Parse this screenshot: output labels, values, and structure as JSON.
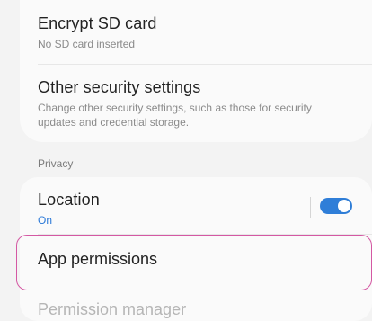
{
  "security": {
    "encrypt_sd": {
      "title": "Encrypt SD card",
      "subtitle": "No SD card inserted"
    },
    "other_security": {
      "title": "Other security settings",
      "subtitle": "Change other security settings, such as those for security updates and credential storage."
    }
  },
  "privacy": {
    "header": "Privacy",
    "location": {
      "title": "Location",
      "status": "On",
      "enabled": true
    },
    "app_permissions": {
      "title": "App permissions"
    },
    "faded_next_item": "Permission manager"
  },
  "colors": {
    "accent": "#2f7ed8",
    "highlight": "#d458a3"
  }
}
